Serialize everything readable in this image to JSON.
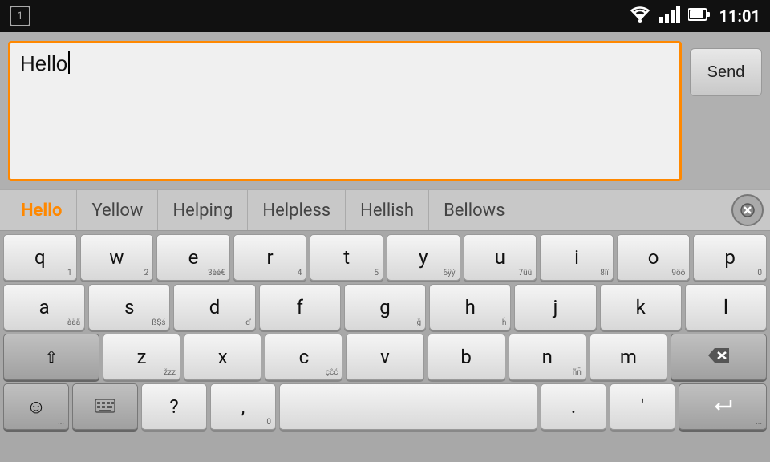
{
  "statusBar": {
    "notificationNum": "1",
    "time": "11:01"
  },
  "inputArea": {
    "text": "Hello",
    "sendLabel": "Send",
    "placeholder": ""
  },
  "suggestions": [
    {
      "id": "s1",
      "text": "Hello",
      "active": true
    },
    {
      "id": "s2",
      "text": "Yellow",
      "active": false
    },
    {
      "id": "s3",
      "text": "Helping",
      "active": false
    },
    {
      "id": "s4",
      "text": "Helpless",
      "active": false
    },
    {
      "id": "s5",
      "text": "Hellish",
      "active": false
    },
    {
      "id": "s6",
      "text": "Bellows",
      "active": false
    }
  ],
  "keyboard": {
    "rows": [
      [
        {
          "main": "q",
          "sub": "1"
        },
        {
          "main": "w",
          "sub": "2"
        },
        {
          "main": "e",
          "sub": "3èé€"
        },
        {
          "main": "r",
          "sub": "4"
        },
        {
          "main": "t",
          "sub": "5"
        },
        {
          "main": "y",
          "sub": "6ÿý"
        },
        {
          "main": "u",
          "sub": "7üū"
        },
        {
          "main": "i",
          "sub": "8īï"
        },
        {
          "main": "o",
          "sub": "9öō"
        },
        {
          "main": "p",
          "sub": "0"
        }
      ],
      [
        {
          "main": "a",
          "sub": "àäã"
        },
        {
          "main": "s",
          "sub": "ßŞś"
        },
        {
          "main": "d",
          "sub": "ď"
        },
        {
          "main": "f",
          "sub": ""
        },
        {
          "main": "g",
          "sub": "ğ"
        },
        {
          "main": "h",
          "sub": "ĥ"
        },
        {
          "main": "j",
          "sub": ""
        },
        {
          "main": "k",
          "sub": ""
        },
        {
          "main": "l",
          "sub": ""
        }
      ],
      [
        {
          "main": "⇧",
          "sub": "",
          "wide": true,
          "dark": true,
          "id": "shift"
        },
        {
          "main": "z",
          "sub": "žžz"
        },
        {
          "main": "x",
          "sub": ""
        },
        {
          "main": "c",
          "sub": "çĉć"
        },
        {
          "main": "v",
          "sub": ""
        },
        {
          "main": "b",
          "sub": ""
        },
        {
          "main": "n",
          "sub": "ñn̄"
        },
        {
          "main": "m",
          "sub": ""
        },
        {
          "main": "⌫",
          "sub": "",
          "wide": true,
          "dark": true,
          "id": "delete"
        }
      ],
      [
        {
          "main": "☺",
          "sub": "...",
          "dark": true,
          "id": "emoji"
        },
        {
          "main": "⌨",
          "sub": "",
          "dark": true,
          "id": "keyboard-switch"
        },
        {
          "main": "?",
          "sub": "",
          "id": "question"
        },
        {
          "main": ",",
          "sub": "0",
          "id": "comma"
        },
        {
          "main": "",
          "sub": "",
          "spacebar": true,
          "id": "space"
        },
        {
          "main": ".",
          "sub": "",
          "id": "period"
        },
        {
          "main": "'",
          "sub": "",
          "id": "apostrophe"
        },
        {
          "main": "↵",
          "sub": "...",
          "wide": true,
          "dark": true,
          "id": "enter"
        }
      ]
    ]
  }
}
